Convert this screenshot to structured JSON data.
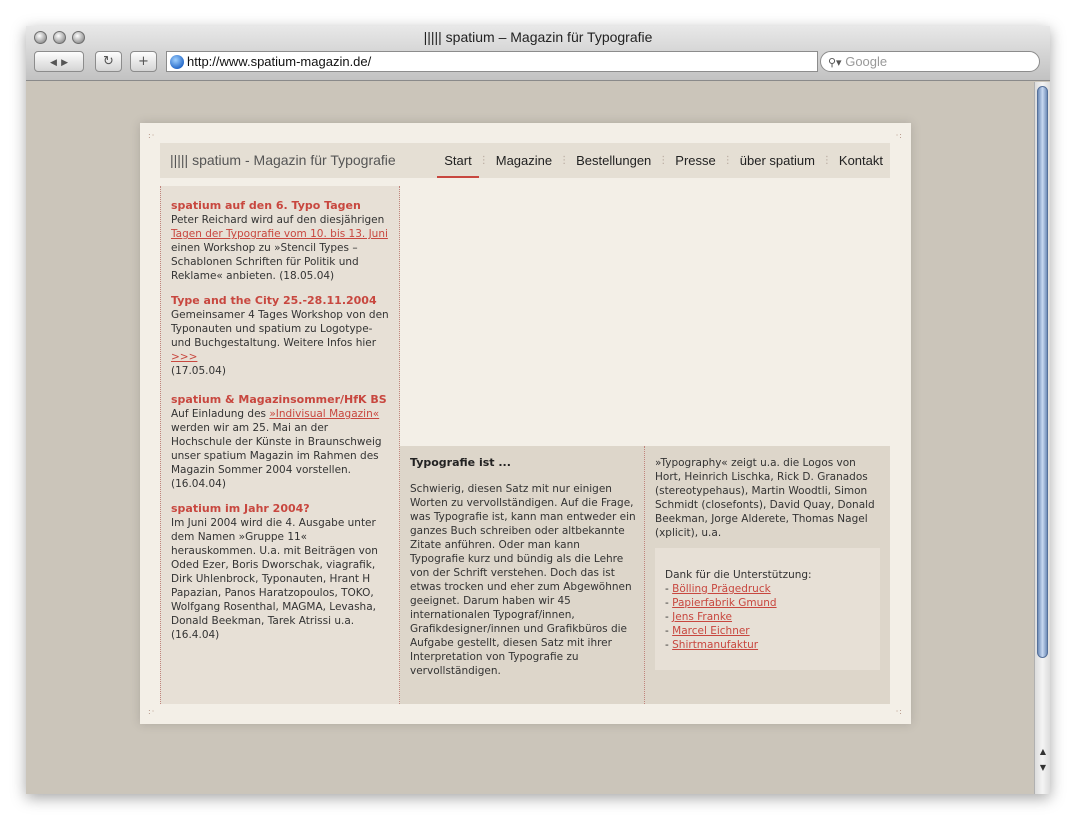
{
  "window": {
    "title": "||||| spatium – Magazin für Typografie"
  },
  "toolbar": {
    "back_icon": "◀",
    "forward_icon": "▶",
    "reload_icon": "↻",
    "add_icon": "+",
    "url": "http://www.spatium-magazin.de/",
    "search_placeholder": "Google"
  },
  "site": {
    "logo": "||||| spatium - Magazin für Typografie",
    "nav": [
      "Start",
      "Magazine",
      "Bestellungen",
      "Presse",
      "über spatium",
      "Kontakt"
    ]
  },
  "news": [
    {
      "title": "spatium auf den 6. Typo Tagen",
      "before": "Peter Reichard wird auf den diesjährigen",
      "link": "Tagen der Typografie vom 10. bis 13. Juni",
      "after": "einen Workshop zu »Stencil Types – Schablonen Schriften für Politik und Reklame« anbieten. (18.05.04)"
    },
    {
      "title": "Type and the City 25.-28.11.2004",
      "before": "Gemeinsamer 4 Tages Workshop von den Typonauten und spatium zu Logotype- und Buchgestaltung. Weitere Infos hier",
      "link": ">>>",
      "after": "(17.05.04)"
    },
    {
      "title": "spatium & Magazinsommer/HfK BS",
      "before": "Auf Einladung des",
      "link": "»Indivisual Magazin«",
      "after": "werden wir am 25. Mai an der Hochschule der Künste in Braunschweig unser spatium Magazin im Rahmen des Magazin Sommer 2004 vorstellen. (16.04.04)"
    },
    {
      "title": "spatium im Jahr 2004?",
      "before": "Im Juni 2004 wird die 4. Ausgabe unter dem Namen »Gruppe 11« herauskommen. U.a. mit Beiträgen von Oded Ezer, Boris Dworschak, viagrafik, Dirk Uhlenbrock, Typonauten, Hrant H Papazian, Panos Haratzopoulos, TOKO, Wolfgang Rosenthal, MAGMA, Levasha, Donald Beekman, Tarek Atrissi u.a.(16.4.04)",
      "link": "",
      "after": ""
    }
  ],
  "mid": {
    "title": "Typografie ist ...",
    "text": "Schwierig, diesen Satz mit nur einigen Worten zu vervollständigen. Auf die Frage, was Typografie ist, kann man entweder ein ganzes Buch schreiben oder altbekannte Zitate anführen. Oder man kann Typografie kurz und bündig als die Lehre von der Schrift verstehen. Doch das ist etwas trocken und eher zum Abgewöhnen geeignet. Darum haben wir 45 internationalen Typograf/innen, Grafikdesigner/innen und Grafikbüros die Aufgabe gestellt, diesen Satz mit ihrer Interpretation von Typografie zu vervollständigen."
  },
  "right": {
    "text": "»Typography« zeigt u.a. die Logos von Hort, Heinrich Lischka, Rick D. Granados (stereotypehaus), Martin Woodtli, Simon Schmidt (closefonts), David Quay, Donald Beekman, Jorge Alderete, Thomas Nagel (xplicit), u.a.",
    "thanks_title": "Dank für die Unterstützung:",
    "sponsors": [
      "Bölling Prägedruck",
      "Papierfabrik Gmund",
      "Jens Franke",
      "Marcel Eichner",
      "Shirtmanufaktur"
    ]
  }
}
